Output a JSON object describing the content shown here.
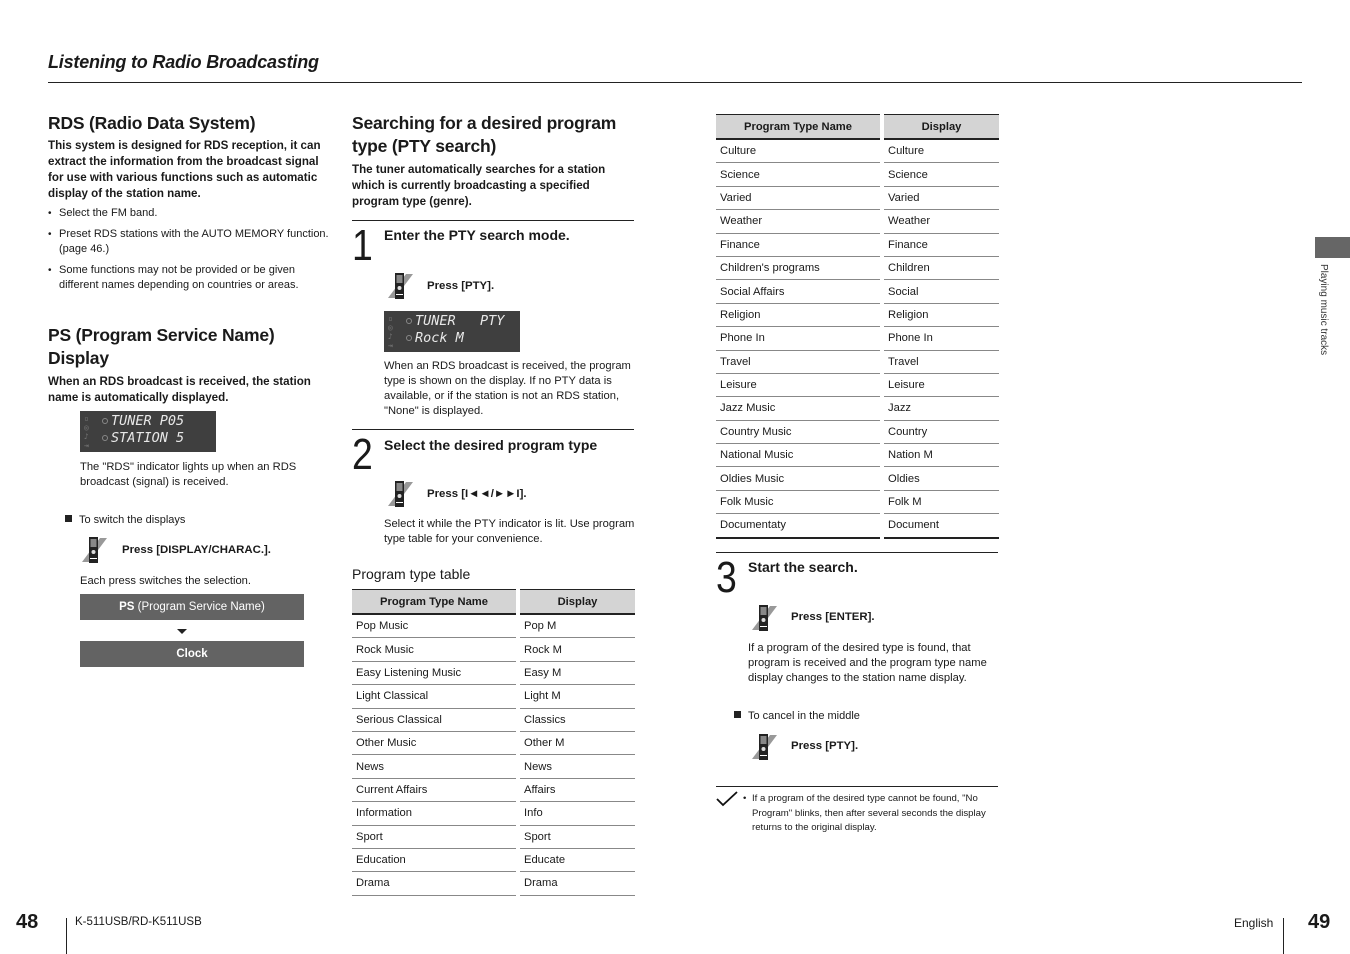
{
  "header": {
    "title": "Listening to Radio Broadcasting"
  },
  "rds": {
    "heading": "RDS (Radio Data System)",
    "lead": "This system is designed for RDS reception, it can extract the information from the broadcast signal for use with various functions such as automatic display of the station name.",
    "bullets": [
      "Select the FM band.",
      "Preset RDS stations with the AUTO MEMORY function. (page 46.)",
      "Some functions may not be provided or be given different names depending on countries or areas."
    ]
  },
  "ps": {
    "heading_line1": "PS (Program Service Name)",
    "heading_line2": "Display",
    "lead": "When an RDS broadcast is received, the station name is automatically displayed.",
    "lcd_line1": "TUNER P05",
    "lcd_line2": "STATION 5",
    "note": "The \"RDS\" indicator lights up when an RDS broadcast (signal) is received.",
    "switch_title": "To switch the displays",
    "press": "Press [DISPLAY/CHARAC.].",
    "each_press": "Each press switches the selection.",
    "flow": [
      {
        "bold": "PS",
        "rest": " (Program Service Name)"
      },
      {
        "bold": "Clock",
        "rest": ""
      }
    ]
  },
  "pty": {
    "heading_line1": "Searching for a desired program",
    "heading_line2": "type (PTY search)",
    "lead": "The tuner automatically searches for a station which is currently broadcasting a specified program type (genre).",
    "steps": [
      {
        "num": "1",
        "title": "Enter the PTY search mode.",
        "press": "Press [PTY].",
        "lcd_line1": "TUNER   PTY",
        "lcd_line2": "Rock M",
        "desc": "When an RDS broadcast is received, the program type is shown on the display. If no PTY data is available, or if the station is not an RDS station, \"None\" is displayed."
      },
      {
        "num": "2",
        "title": "Select the desired program type",
        "press": "Press [I◄◄/►►I].",
        "desc": "Select it while the PTY indicator is lit. Use program type table for your convenience."
      },
      {
        "num": "3",
        "title": "Start the search.",
        "press": "Press [ENTER].",
        "desc": "If a program of the desired type is found, that program is received and the program type name display changes to the station name display."
      }
    ],
    "cancel_title": "To cancel in the middle",
    "cancel_press": "Press [PTY].",
    "note": "If a program of the desired type cannot be found, \"No Program\" blinks, then after several seconds the display returns to the original display."
  },
  "table": {
    "caption": "Program type table",
    "headers": [
      "Program Type Name",
      "Display"
    ],
    "rows_left": [
      [
        "Pop Music",
        "Pop M"
      ],
      [
        "Rock Music",
        "Rock M"
      ],
      [
        "Easy Listening Music",
        "Easy M"
      ],
      [
        "Light Classical",
        "Light M"
      ],
      [
        "Serious Classical",
        "Classics"
      ],
      [
        "Other Music",
        "Other M"
      ],
      [
        "News",
        "News"
      ],
      [
        "Current Affairs",
        "Affairs"
      ],
      [
        "Information",
        "Info"
      ],
      [
        "Sport",
        "Sport"
      ],
      [
        "Education",
        "Educate"
      ],
      [
        "Drama",
        "Drama"
      ]
    ],
    "rows_right": [
      [
        "Culture",
        "Culture"
      ],
      [
        "Science",
        "Science"
      ],
      [
        "Varied",
        "Varied"
      ],
      [
        "Weather",
        "Weather"
      ],
      [
        "Finance",
        "Finance"
      ],
      [
        "Children's programs",
        "Children"
      ],
      [
        "Social Affairs",
        "Social"
      ],
      [
        "Religion",
        "Religion"
      ],
      [
        "Phone In",
        "Phone In"
      ],
      [
        "Travel",
        "Travel"
      ],
      [
        "Leisure",
        "Leisure"
      ],
      [
        "Jazz Music",
        "Jazz"
      ],
      [
        "Country Music",
        "Country"
      ],
      [
        "National Music",
        "Nation M"
      ],
      [
        "Oldies Music",
        "Oldies"
      ],
      [
        "Folk Music",
        "Folk M"
      ],
      [
        "Documentaty",
        "Document"
      ]
    ]
  },
  "side_tab": {
    "label": "Playing music tracks"
  },
  "footer": {
    "left_page": "48",
    "model": "K-511USB/RD-K511USB",
    "language": "English",
    "right_page": "49"
  }
}
